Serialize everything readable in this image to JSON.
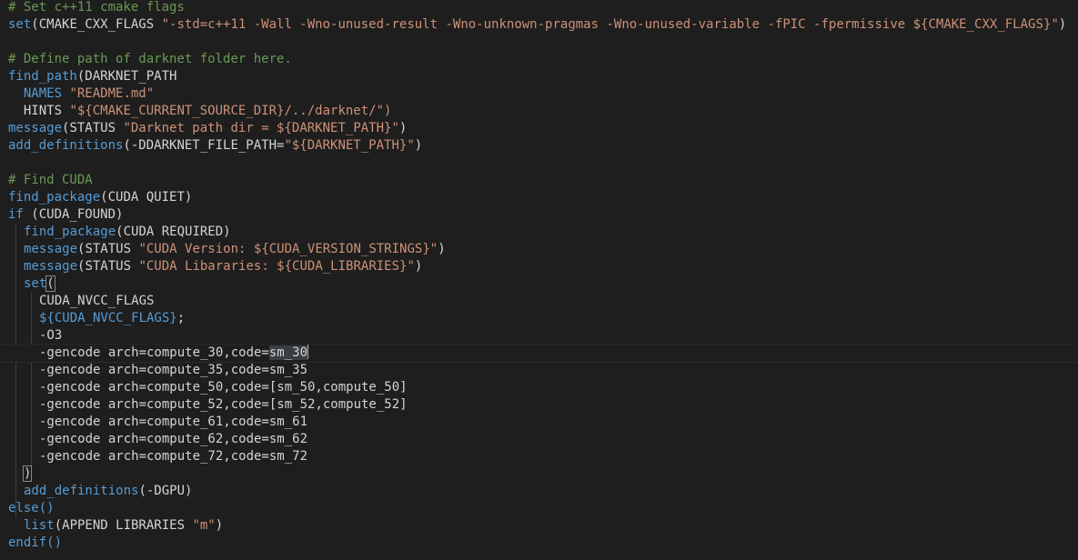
{
  "code": {
    "l1": "# Set c++11 cmake flags",
    "l2_fn": "set",
    "l2_open": "(CMAKE_CXX_FLAGS ",
    "l2_str": "\"-std=c++11 -Wall -Wno-unused-result -Wno-unknown-pragmas -Wno-unused-variable -fPIC -fpermissive ${CMAKE_CXX_FLAGS}\"",
    "l2_close": ")",
    "l4": "# Define path of darknet folder here.",
    "l5_fn": "find_path",
    "l5_rest": "(DARKNET_PATH",
    "l6_kw": "  NAMES ",
    "l6_str": "\"README.md\"",
    "l7_kw": "  HINTS ",
    "l7_str": "\"${CMAKE_CURRENT_SOURCE_DIR}/../darknet/\")",
    "l8_fn": "message",
    "l8_open": "(STATUS ",
    "l8_str": "\"Darknet path dir = ${DARKNET_PATH}\"",
    "l8_close": ")",
    "l9_fn": "add_definitions",
    "l9_open": "(-DDARKNET_FILE_PATH=",
    "l9_str": "\"${DARKNET_PATH}\"",
    "l9_close": ")",
    "l11": "# Find CUDA",
    "l12_fn": "find_package",
    "l12_rest": "(CUDA QUIET)",
    "l13_kw": "if",
    "l13_rest": " (CUDA_FOUND)",
    "l14_fn": "find_package",
    "l14_rest": "(CUDA REQUIRED)",
    "l15_fn": "message",
    "l15_open": "(STATUS ",
    "l15_str": "\"CUDA Version: ${CUDA_VERSION_STRINGS}\"",
    "l15_close": ")",
    "l16_fn": "message",
    "l16_open": "(STATUS ",
    "l16_str": "\"CUDA Libararies: ${CUDA_LIBRARIES}\"",
    "l16_close": ")",
    "l17_fn": "set",
    "l17_paren": "(",
    "l18": "CUDA_NVCC_FLAGS",
    "l19_var": "${CUDA_NVCC_FLAGS}",
    "l19_rest": ";",
    "l20": "-O3",
    "l21_pre": "-gencode arch=compute_30,code=",
    "l21_sel": "sm_30",
    "l22": "-gencode arch=compute_35,code=sm_35",
    "l23": "-gencode arch=compute_50,code=[sm_50,compute_50]",
    "l24": "-gencode arch=compute_52,code=[sm_52,compute_52]",
    "l25": "-gencode arch=compute_61,code=sm_61",
    "l26": "-gencode arch=compute_62,code=sm_62",
    "l27": "-gencode arch=compute_72,code=sm_72",
    "l28": ")",
    "l29_fn": "add_definitions",
    "l29_rest": "(-DGPU)",
    "l30": "else()",
    "l31_fn": "list",
    "l31_open": "(APPEND LIBRARIES ",
    "l31_str": "\"m\"",
    "l31_close": ")",
    "l32": "endif()"
  },
  "colors": {
    "background": "#1e1e1e",
    "comment": "#6a9955",
    "keyword": "#569cd6",
    "string": "#ce9178",
    "text": "#d4d4d4"
  }
}
